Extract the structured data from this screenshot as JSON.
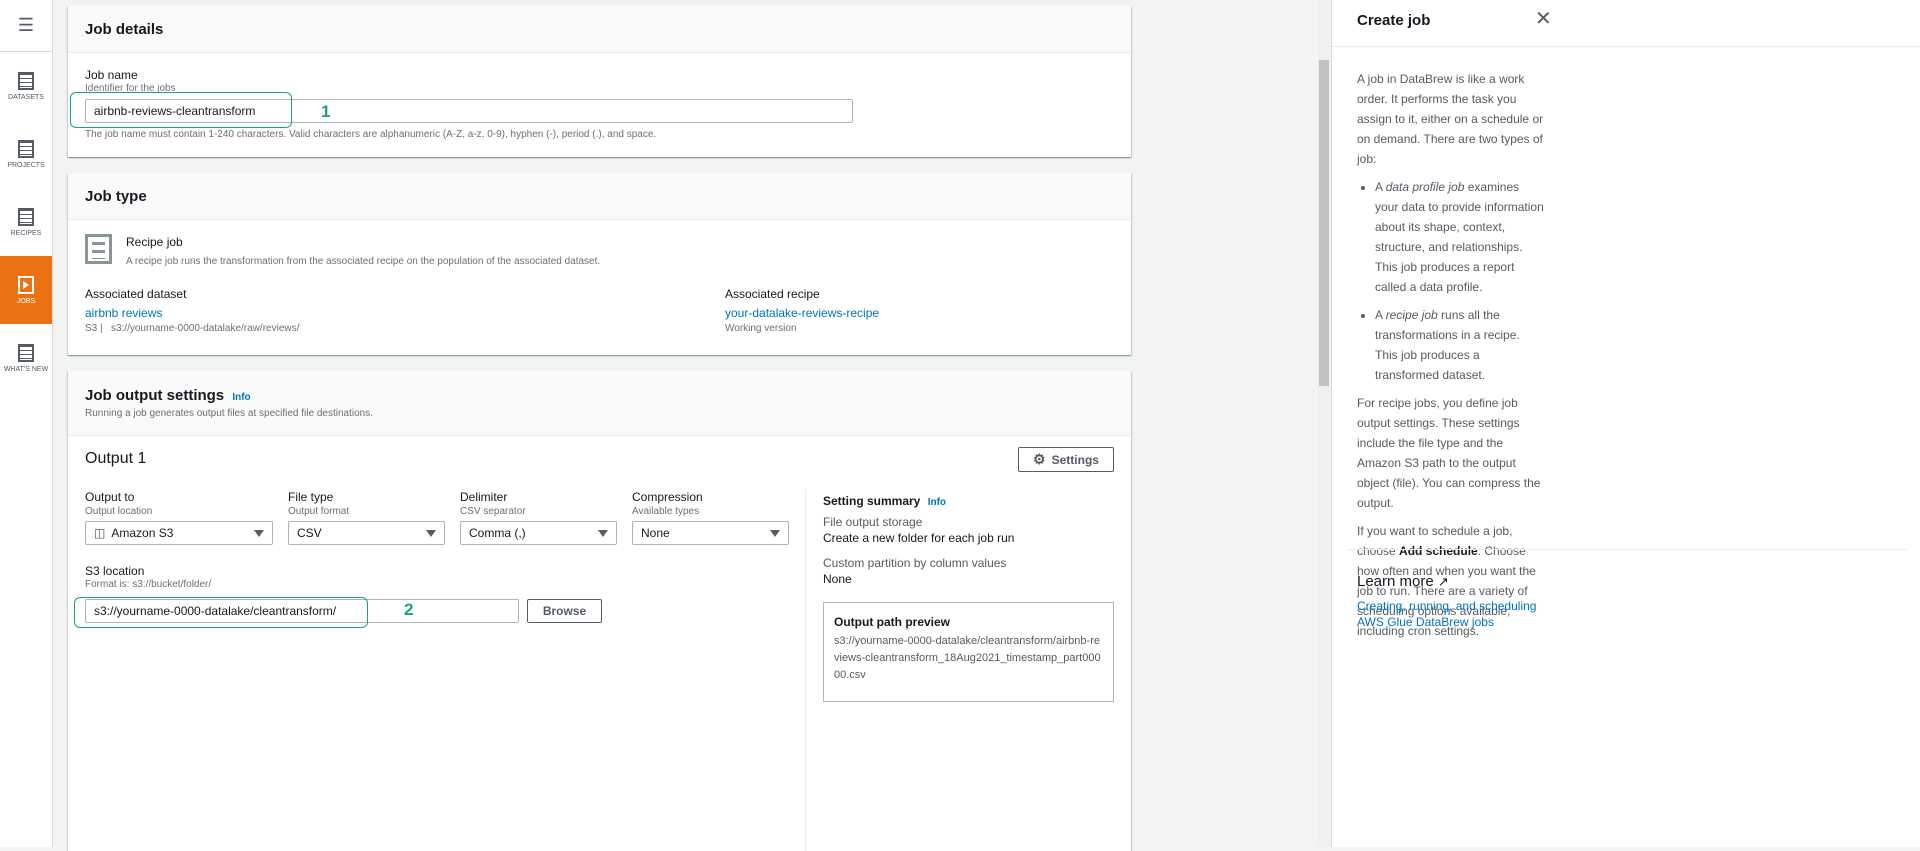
{
  "sidebar": {
    "items": [
      {
        "label": "DATASETS",
        "icon": "table-icon"
      },
      {
        "label": "PROJECTS",
        "icon": "grid-icon"
      },
      {
        "label": "RECIPES",
        "icon": "list-icon"
      },
      {
        "label": "JOBS",
        "icon": "play-icon",
        "active": true
      },
      {
        "label": "WHAT'S NEW",
        "icon": "news-icon"
      }
    ]
  },
  "job_details": {
    "title": "Job details",
    "name_label": "Job name",
    "name_desc": "Identifier for the jobs",
    "name_value": "airbnb-reviews-cleantransform",
    "constraint": "The job name must contain 1-240 characters. Valid characters are alphanumeric (A-Z, a-z, 0-9), hyphen (-), period (.), and space.",
    "annotation": "1"
  },
  "job_type": {
    "title": "Job type",
    "type_label": "Recipe job",
    "type_desc": "A recipe job runs the transformation from the associated recipe on the population of the associated dataset.",
    "dataset_label": "Associated dataset",
    "dataset_name": "airbnb reviews",
    "dataset_source": "S3 |",
    "dataset_path": "s3://yourname-0000-datalake/raw/reviews/",
    "recipe_label": "Associated recipe",
    "recipe_name": "your-datalake-reviews-recipe",
    "recipe_version": "Working version"
  },
  "output_settings": {
    "title": "Job output settings",
    "info": "Info",
    "desc": "Running a job generates output files at specified file destinations.",
    "output_title": "Output 1",
    "settings_button": "Settings",
    "output_to": {
      "label": "Output to",
      "desc": "Output location",
      "value": "Amazon S3"
    },
    "file_type": {
      "label": "File type",
      "desc": "Output format",
      "value": "CSV"
    },
    "delimiter": {
      "label": "Delimiter",
      "desc": "CSV separator",
      "value": "Comma (,)"
    },
    "compression": {
      "label": "Compression",
      "desc": "Available types",
      "value": "None"
    },
    "s3": {
      "label": "S3 location",
      "desc": "Format is: s3://bucket/folder/",
      "value": "s3://yourname-0000-datalake/cleantransform/",
      "browse": "Browse",
      "annotation": "2"
    },
    "summary": {
      "title": "Setting summary",
      "info": "Info",
      "storage_label": "File output storage",
      "storage_value": "Create a new folder for each job run",
      "partition_label": "Custom partition by column values",
      "partition_value": "None",
      "preview_title": "Output path preview",
      "preview_value": "s3://yourname-0000-datalake/cleantransform/airbnb-reviews-cleantransform_18Aug2021_timestamp_part00000.csv"
    }
  },
  "help_panel": {
    "title": "Create job",
    "p1": "A job in DataBrew is like a work order. It performs the task you assign to it, either on a schedule or on demand. There are two types of job:",
    "b1_pre": "A ",
    "b1_em": "data profile job",
    "b1_post": " examines your data to provide information about its shape, context, structure, and relationships. This job produces a report called a data profile.",
    "b2_pre": "A ",
    "b2_em": "recipe job",
    "b2_post": " runs all the transformations in a recipe. This job produces a transformed dataset.",
    "p2": "For recipe jobs, you define job output settings. These settings include the file type and the Amazon S3 path to the output object (file). You can compress the output.",
    "p3_pre": "If you want to schedule a job, choose ",
    "p3_strong": "Add schedule",
    "p3_post": ". Choose how often and when you want the job to run. There are a variety of scheduling options available, including cron settings.",
    "learn_more": "Learn more",
    "link": "Creating, running, and scheduling AWS Glue DataBrew jobs"
  }
}
